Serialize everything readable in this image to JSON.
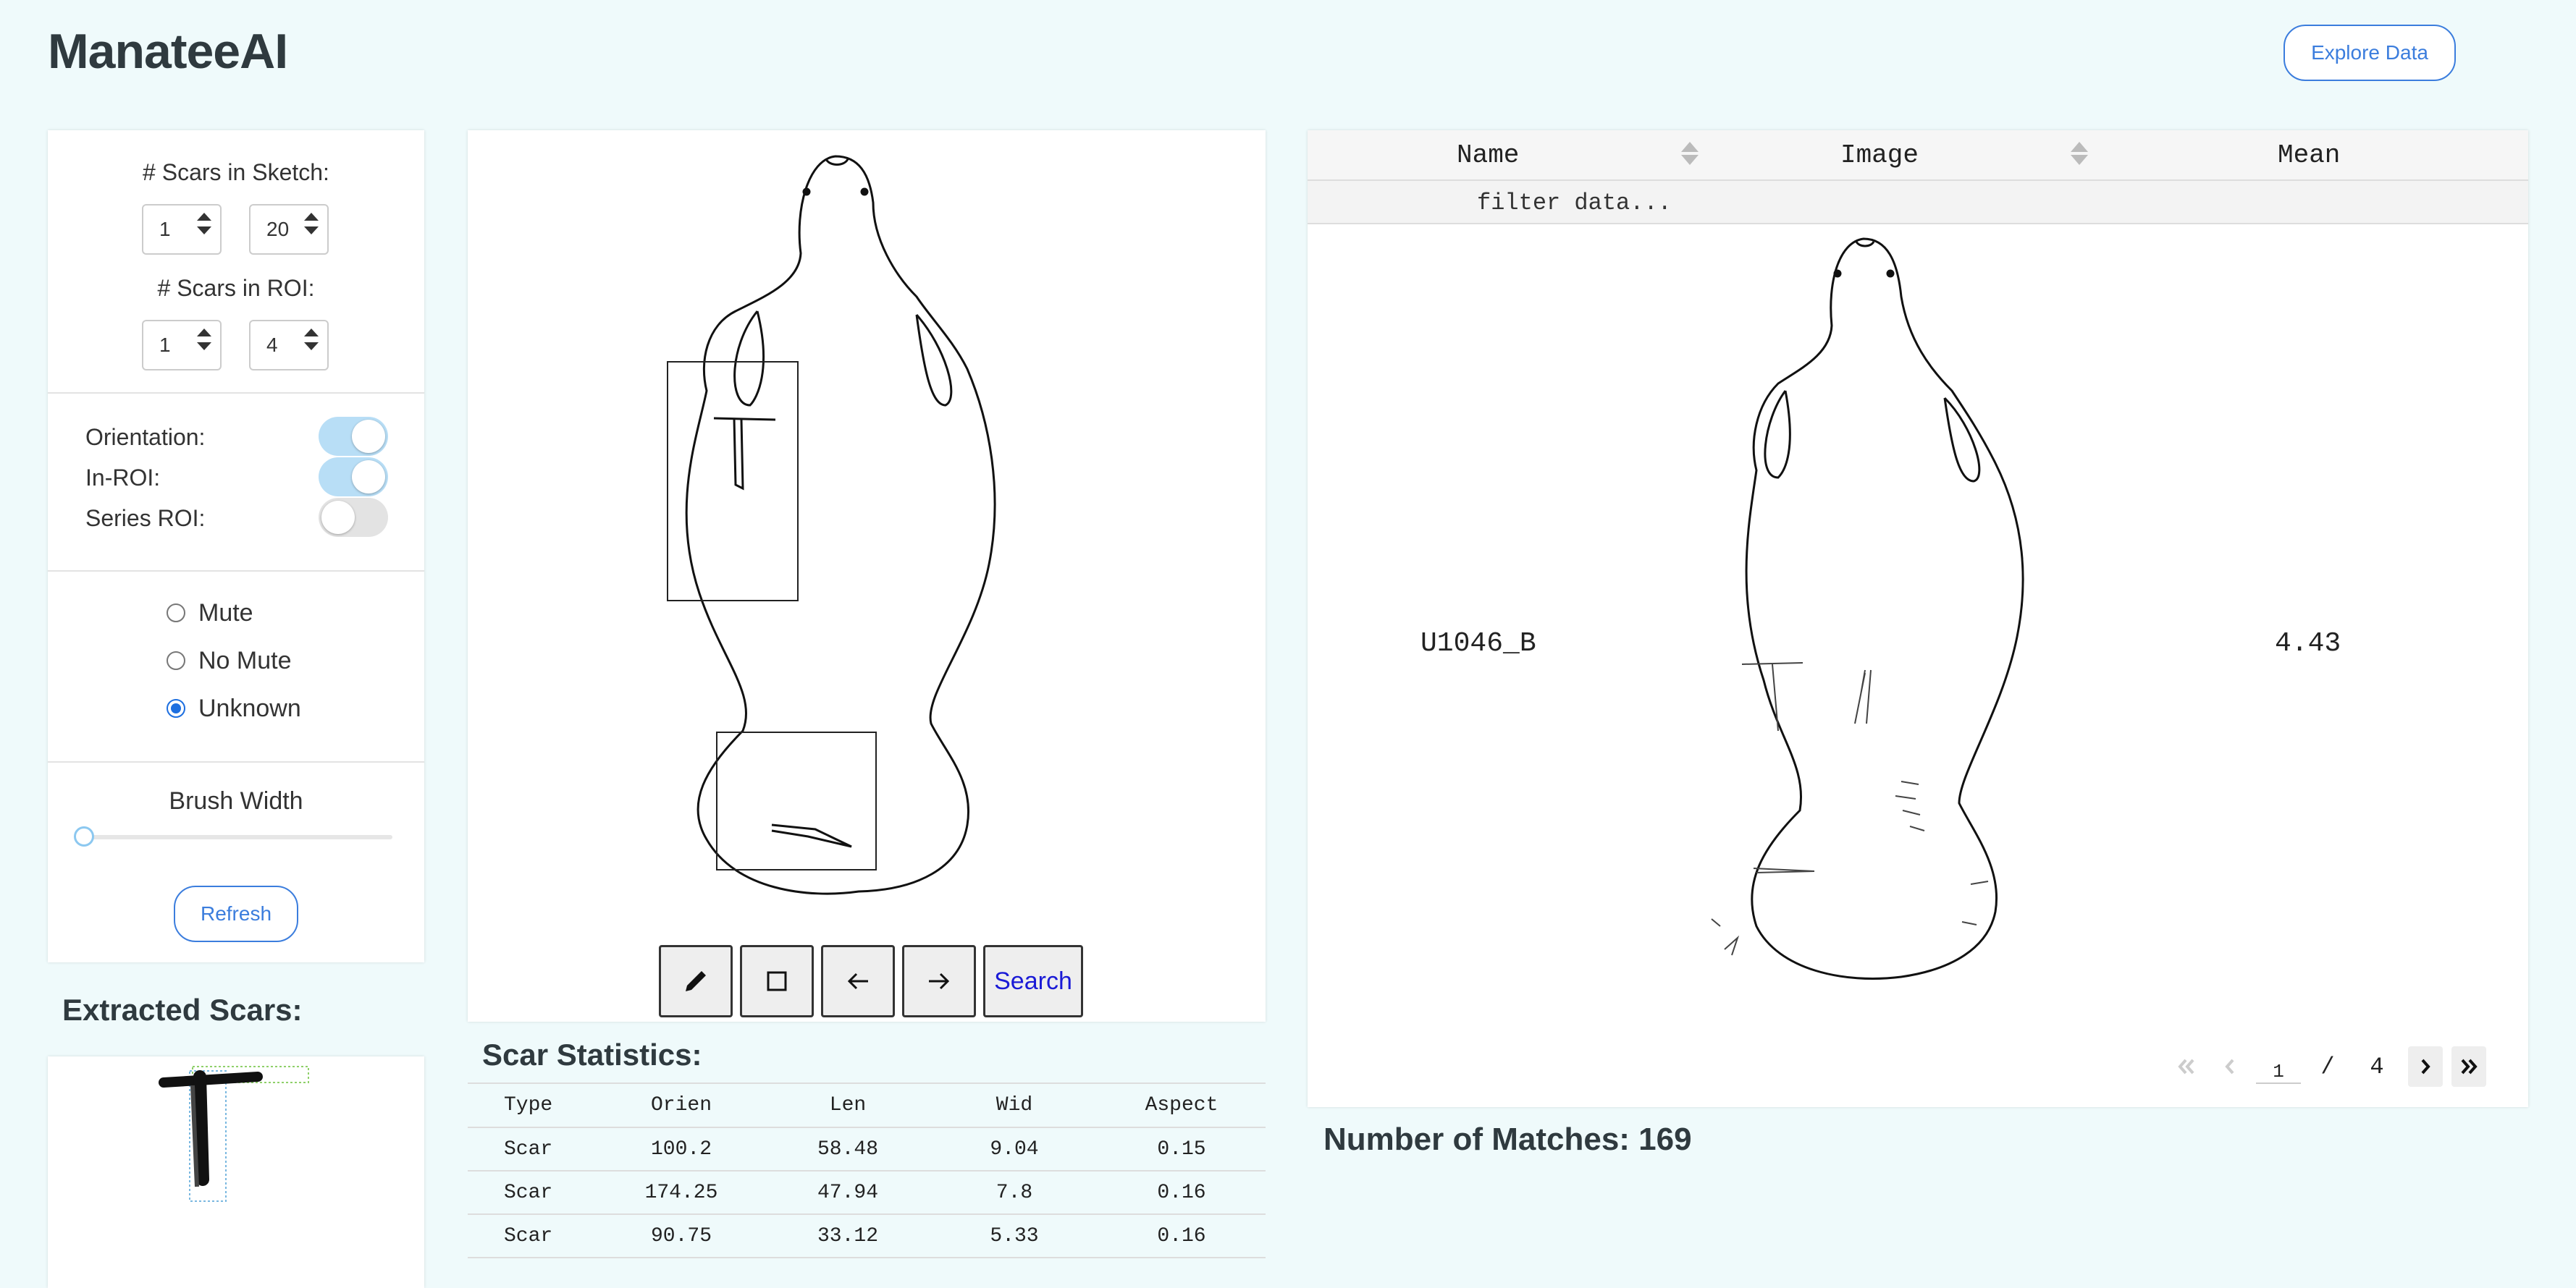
{
  "app": {
    "title": "ManateeAI",
    "explore_label": "Explore Data"
  },
  "controls": {
    "scars_sketch_label": "# Scars in Sketch:",
    "scars_sketch_min": "1",
    "scars_sketch_max": "20",
    "scars_roi_label": "# Scars in ROI:",
    "scars_roi_min": "1",
    "scars_roi_max": "4",
    "toggles": [
      {
        "label": "Orientation:",
        "on": true
      },
      {
        "label": "In-ROI:",
        "on": true
      },
      {
        "label": "Series ROI:",
        "on": false
      }
    ],
    "radios": [
      {
        "label": "Mute",
        "checked": false
      },
      {
        "label": "No Mute",
        "checked": false
      },
      {
        "label": "Unknown",
        "checked": true
      }
    ],
    "brush_label": "Brush Width",
    "brush_value": 0,
    "refresh_label": "Refresh"
  },
  "extracted": {
    "heading": "Extracted Scars:"
  },
  "sketch": {
    "tools": [
      "pencil-icon",
      "square-icon",
      "arrow-left-icon",
      "arrow-right-icon"
    ],
    "search_label": "Search"
  },
  "stats": {
    "heading": "Scar Statistics:",
    "columns": [
      "Type",
      "Orien",
      "Len",
      "Wid",
      "Aspect"
    ],
    "rows": [
      [
        "Scar",
        "100.2",
        "58.48",
        "9.04",
        "0.15"
      ],
      [
        "Scar",
        "174.25",
        "47.94",
        "7.8",
        "0.16"
      ],
      [
        "Scar",
        "90.75",
        "33.12",
        "5.33",
        "0.16"
      ]
    ]
  },
  "results": {
    "columns": [
      "Name",
      "Image",
      "Mean"
    ],
    "filter_placeholder": "filter data...",
    "row": {
      "name": "U1046_B",
      "mean": "4.43"
    },
    "page_current": "1",
    "page_sep": "/",
    "page_total": "4",
    "matches_text": "Number of Matches: 169"
  }
}
